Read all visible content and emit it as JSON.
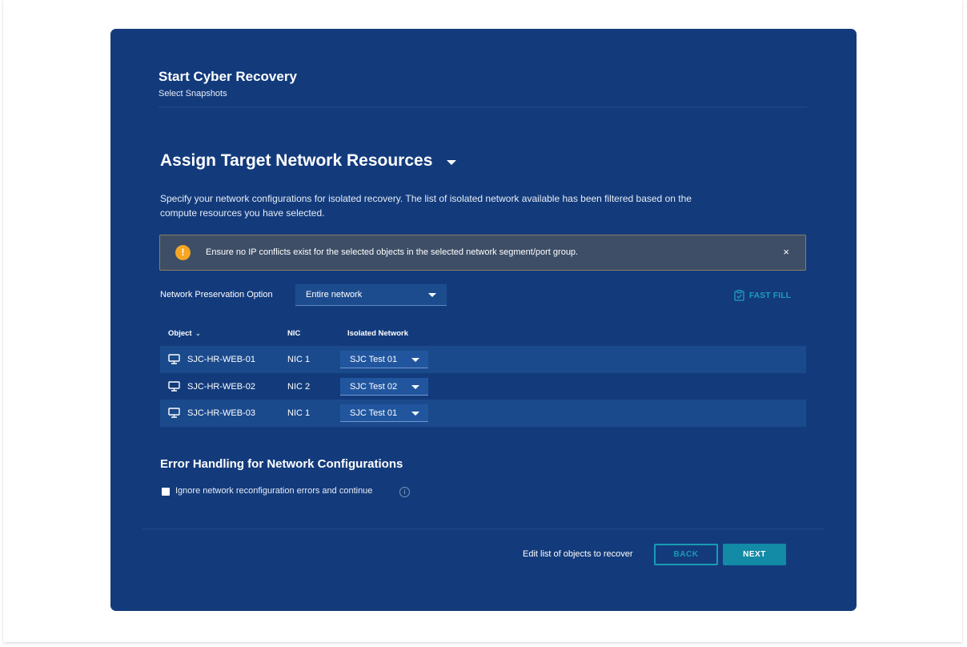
{
  "dialog": {
    "title": "Start Cyber Recovery",
    "subtitle": "Select Snapshots"
  },
  "section": {
    "title": "Assign Target Network Resources",
    "icon": "chevron-down-icon",
    "description": "Specify your network configurations for isolated recovery. The list of isolated network available has been filtered based on the compute resources you have selected."
  },
  "alert": {
    "icon": "warning-icon",
    "icon_glyph": "!",
    "message": "Ensure no IP conflicts exist for the selected objects in the selected network segment/port group.",
    "close_glyph": "×",
    "icon_color": "#f5a623"
  },
  "network_preservation": {
    "label": "Network Preservation Option",
    "selected": "Entire network"
  },
  "fast_fill": {
    "label": "FAST FILL",
    "icon": "clipboard-check-icon",
    "color": "#1e9fbf"
  },
  "table": {
    "headers": {
      "object": "Object",
      "object_sort_glyph": "⌄",
      "nic": "NIC",
      "isolated_network": "Isolated Network"
    },
    "rows": [
      {
        "object": "SJC-HR-WEB-01",
        "nic": "NIC 1",
        "isolated_network": "SJC Test 01",
        "icon": "monitor-icon"
      },
      {
        "object": "SJC-HR-WEB-02",
        "nic": "NIC 2",
        "isolated_network": "SJC Test 02",
        "icon": "monitor-icon"
      },
      {
        "object": "SJC-HR-WEB-03",
        "nic": "NIC 1",
        "isolated_network": "SJC Test 01",
        "icon": "monitor-icon"
      }
    ]
  },
  "error_handling": {
    "title": "Error Handling for Network Configurations",
    "checkbox_label": "Ignore network reconfiguration errors and continue",
    "checked": false,
    "info_glyph": "i"
  },
  "footer": {
    "edit_link": "Edit list of objects to recover",
    "back_label": "BACK",
    "next_label": "NEXT",
    "accent": "#138aa6"
  },
  "colors": {
    "dialog_bg": "#133b7c",
    "row_alt_bg": "#1b4a8c",
    "page_bg": "#ffffff"
  }
}
